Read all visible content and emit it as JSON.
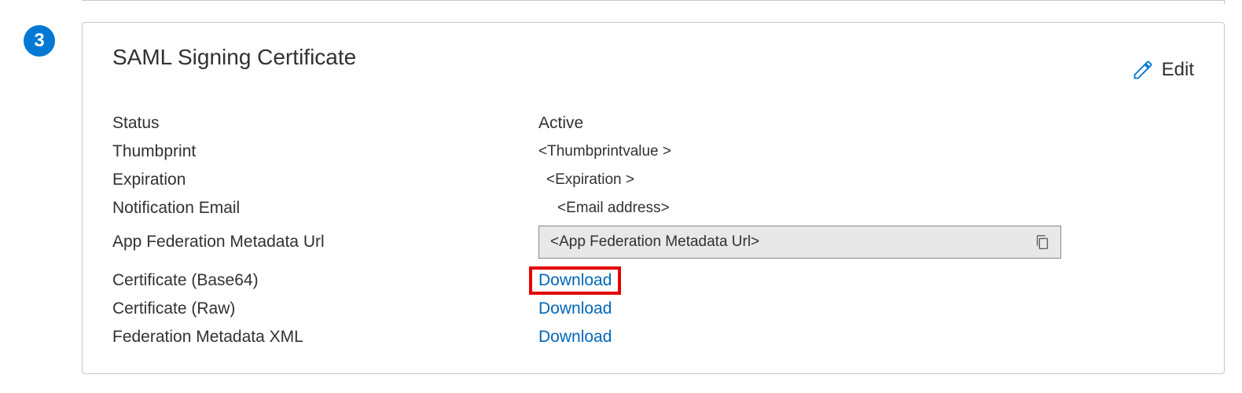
{
  "step_number": "3",
  "card": {
    "title": "SAML Signing Certificate",
    "edit_label": "Edit",
    "rows": {
      "status": {
        "label": "Status",
        "value": "Active"
      },
      "thumbprint": {
        "label": "Thumbprint",
        "value": "<Thumbprintvalue >"
      },
      "expiration": {
        "label": "Expiration",
        "value": "<Expiration >"
      },
      "notif_email": {
        "label": "Notification Email",
        "value": "<Email address>"
      },
      "metadata_url": {
        "label": "App Federation Metadata Url",
        "value": "<App Federation Metadata Url>"
      },
      "cert_b64": {
        "label": "Certificate (Base64)",
        "link": "Download"
      },
      "cert_raw": {
        "label": "Certificate (Raw)",
        "link": "Download"
      },
      "fed_xml": {
        "label": "Federation Metadata XML",
        "link": "Download"
      }
    }
  }
}
